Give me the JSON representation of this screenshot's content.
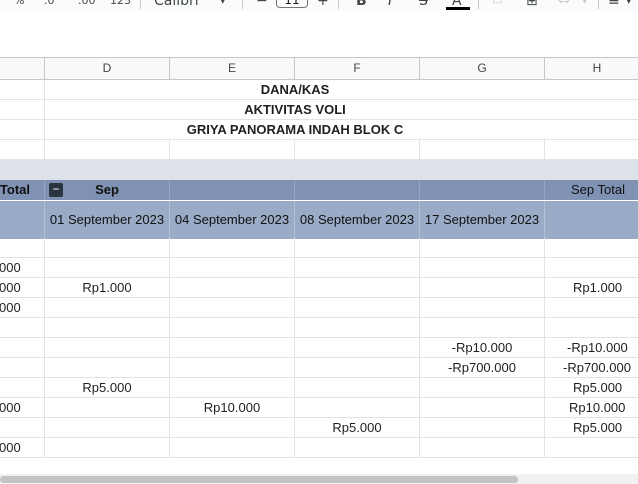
{
  "toolbar": {
    "percent": "%",
    "decimal_decrease": ".0",
    "decimal_increase": ".00",
    "format_number": "123",
    "font_name": "Calibri",
    "font_size": "11",
    "minus": "−",
    "plus": "+",
    "bold": "B",
    "italic": "I",
    "strike": "S",
    "text_color": "A"
  },
  "columns": [
    "D",
    "E",
    "F",
    "G",
    "H"
  ],
  "title_lines": [
    "DANA/KAS",
    "AKTIVITAS VOLI",
    "GRIYA PANORAMA INDAH BLOK C"
  ],
  "header": {
    "left_total": "Total",
    "month": "Sep",
    "month_total": "Sep Total",
    "dates": [
      "01 September 2023",
      "04 September 2023",
      "08 September 2023",
      "17 September 2023"
    ]
  },
  "left_partial": [
    "000",
    "000",
    "000",
    "000",
    "000"
  ],
  "values": {
    "d_row1": "Rp1.000",
    "h_row1": "Rp1.000",
    "g_row2": "-Rp10.000",
    "h_row2": "-Rp10.000",
    "g_row3": "-Rp700.000",
    "h_row3": "-Rp700.000",
    "d_row4": "Rp5.000",
    "h_row4": "Rp5.000",
    "e_row5": "Rp10.000",
    "h_row5": "Rp10.000",
    "f_row6": "Rp5.000",
    "h_row6": "Rp5.000"
  },
  "colors": {
    "band_dark": "#7f92b3",
    "band_light": "#9aabc7",
    "band_grey": "#dde1e8"
  }
}
